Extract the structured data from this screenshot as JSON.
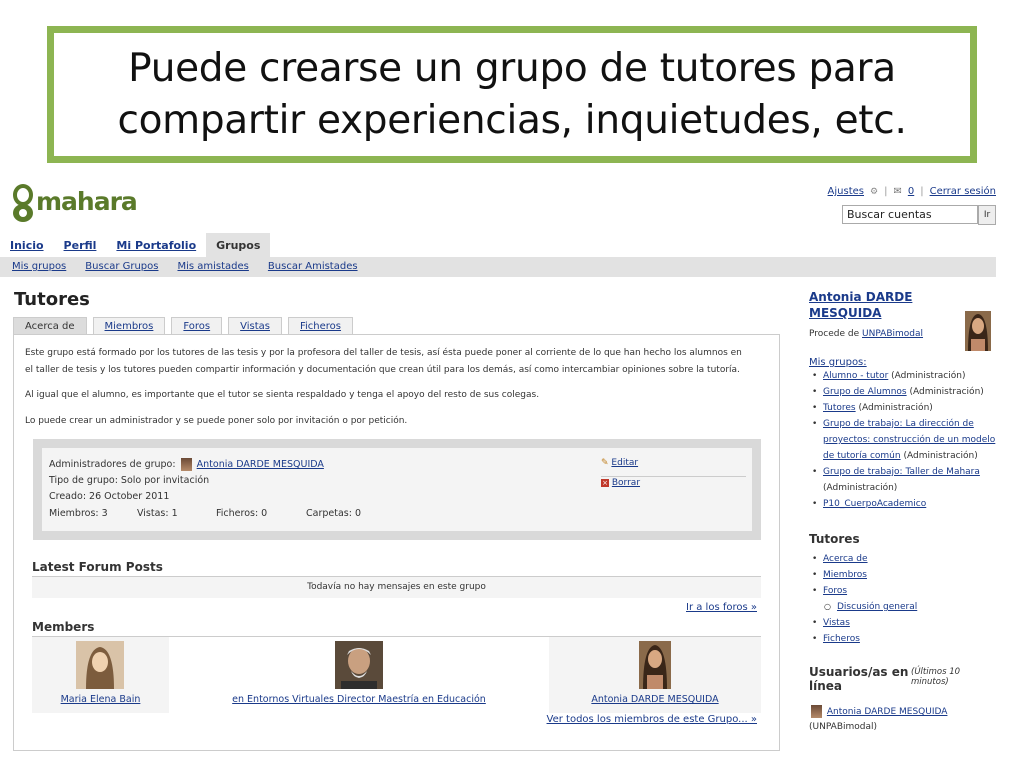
{
  "slide": {
    "title_line1": "Puede crearse un grupo de tutores para",
    "title_line2": "compartir experiencias, inquietudes, etc.",
    "border_color": "#8db552"
  },
  "header": {
    "logo_text": "mahara",
    "links": {
      "settings": "Ajustes",
      "inbox_count": "0",
      "logout": "Cerrar sesión"
    },
    "search": {
      "value": "Buscar cuentas",
      "button": "Ir"
    }
  },
  "nav": {
    "main": [
      "Inicio",
      "Perfil",
      "Mi Portafolio",
      "Grupos"
    ],
    "active": "Grupos",
    "sub": [
      "Mis grupos",
      "Buscar Grupos",
      "Mis amistades",
      "Buscar Amistades"
    ]
  },
  "group": {
    "title": "Tutores",
    "tabs": [
      "Acerca de",
      "Miembros",
      "Foros",
      "Vistas",
      "Ficheros"
    ],
    "description": [
      "Este grupo está formado por los tutores de las tesis y por la profesora del taller de tesis, así ésta puede poner al corriente de lo que han hecho los alumnos en",
      "el taller de tesis y los tutores pueden compartir información y documentación que crean útil para los demás, así como intercambiar opiniones sobre la tutoría.",
      "Al igual que el alumno, es importante que el tutor se sienta respaldado y tenga el apoyo del resto de sus colegas.",
      "Lo puede crear un administrador y se puede poner solo por invitación o por petición."
    ],
    "info": {
      "admins_label": "Administradores de grupo:",
      "admin_name": "Antonia DARDE MESQUIDA",
      "type": "Tipo de grupo: Solo por invitación",
      "created": "Creado: 26 October 2011",
      "members": "Miembros: 3",
      "views": "Vistas: 1",
      "files": "Ficheros: 0",
      "folders": "Carpetas: 0",
      "edit": "Editar",
      "delete": "Borrar"
    },
    "forum": {
      "heading": "Latest Forum Posts",
      "empty": "Todavía no hay mensajes en este grupo",
      "link": "Ir a los foros »"
    },
    "members_section": {
      "heading": "Members",
      "list": [
        "Maria Elena Bain",
        "en Entornos Virtuales Director Maestría en Educación",
        "Antonia DARDE MESQUIDA"
      ],
      "link": "Ver todos los miembros de este Grupo... »"
    }
  },
  "sidebar": {
    "user_line1": "Antonia DARDE",
    "user_line2": "MESQUIDA",
    "from_label": "Procede de",
    "from_value": "UNPABimodal",
    "my_groups_heading": "Mis grupos:",
    "my_groups": [
      {
        "name": "Alumno - tutor",
        "role": "(Administración)"
      },
      {
        "name": "Grupo de Alumnos",
        "role": "(Administración)"
      },
      {
        "name": "Tutores",
        "role": "(Administración)"
      },
      {
        "name_lines": [
          "Grupo de trabajo: La dirección de",
          "proyectos: construcción de un modelo",
          "de tutoría común"
        ],
        "role": "(Administración)"
      },
      {
        "name": "Grupo de trabajo: Taller de Mahara",
        "role": "(Administración)"
      },
      {
        "name": "P10_CuerpoAcademico",
        "role": ""
      }
    ],
    "group_heading": "Tutores",
    "group_links": [
      "Acerca de",
      "Miembros",
      "Foros",
      "Discusión general",
      "Vistas",
      "Ficheros"
    ],
    "online_heading_line1": "Usuarios/as en",
    "online_heading_line2": "línea",
    "online_note": "(Últimos 10 minutos)",
    "online_user": "Antonia DARDE MESQUIDA",
    "online_user_inst": "(UNPABimodal)"
  }
}
